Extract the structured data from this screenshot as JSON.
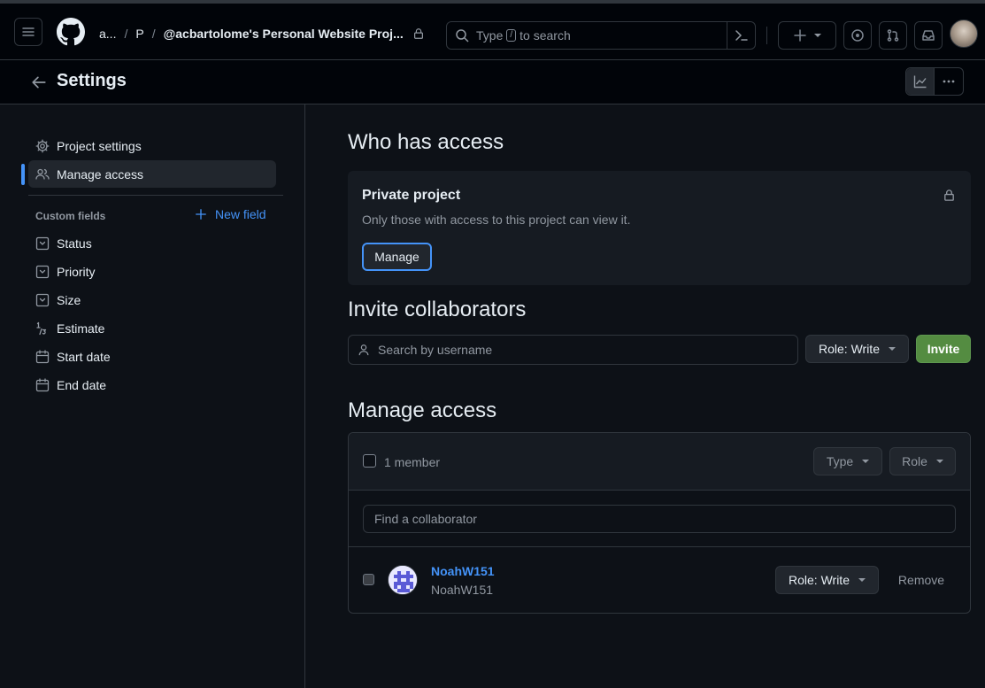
{
  "topbar": {
    "owner_short": "a...",
    "project_short": "P",
    "project_title": "@acbartolome's Personal Website Proj...",
    "search": {
      "prefix": "Type",
      "key": "/",
      "suffix": "to search"
    },
    "icons": [
      "menu-icon",
      "github-logo-icon",
      "lock-icon",
      "search-icon",
      "command-palette-icon",
      "plus-icon",
      "chevron-down-icon",
      "issues-icon",
      "pull-requests-icon",
      "inbox-icon"
    ]
  },
  "subheader": {
    "title": "Settings"
  },
  "sidebar": {
    "items": [
      {
        "label": "Project settings",
        "icon": "gear-icon"
      },
      {
        "label": "Manage access",
        "icon": "people-icon"
      }
    ],
    "custom_fields_label": "Custom fields",
    "new_field_label": "New field",
    "fields": [
      {
        "label": "Status",
        "icon": "single-select-icon"
      },
      {
        "label": "Priority",
        "icon": "single-select-icon"
      },
      {
        "label": "Size",
        "icon": "single-select-icon"
      },
      {
        "label": "Estimate",
        "icon": "number-icon"
      },
      {
        "label": "Start date",
        "icon": "calendar-icon"
      },
      {
        "label": "End date",
        "icon": "calendar-icon"
      }
    ]
  },
  "main": {
    "who_has_access": {
      "heading": "Who has access",
      "card_title": "Private project",
      "card_desc": "Only those with access to this project can view it.",
      "manage_label": "Manage"
    },
    "invite": {
      "heading": "Invite collaborators",
      "placeholder": "Search by username",
      "role_label": "Role: Write",
      "invite_label": "Invite"
    },
    "manage_access": {
      "heading": "Manage access",
      "member_count": "1 member",
      "type_filter": "Type",
      "role_filter": "Role",
      "find_placeholder": "Find a collaborator",
      "members": [
        {
          "name": "NoahW151",
          "username": "NoahW151",
          "role": "Role: Write",
          "remove_label": "Remove"
        }
      ]
    }
  },
  "colors": {
    "accent": "#4493f8",
    "invite_green": "#548c41",
    "background": "#0d1117",
    "border": "#30363d",
    "link": "#4493f8"
  }
}
